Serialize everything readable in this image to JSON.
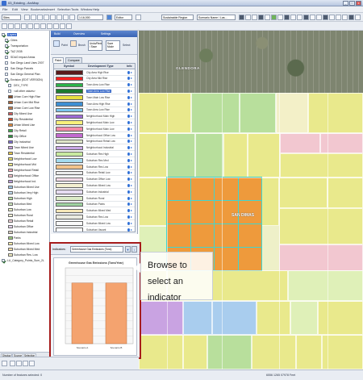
{
  "window": {
    "title": "03_Existing - ArcMap"
  },
  "menu": [
    "File",
    "Edit",
    "View",
    "Bookmarks",
    "Insert",
    "Selection",
    "Tools",
    "Window",
    "Help"
  ],
  "toolbar": {
    "scale": "1:16,000",
    "layer_drop": "Sites",
    "editor": "Editor",
    "zoom_drop": "Sustainable Region",
    "plan_drop": "Scenario Name / Las..."
  },
  "toc": {
    "items": [
      {
        "label": "Layers",
        "level": 0,
        "checked": true,
        "hl": true
      },
      {
        "label": "Cities",
        "level": 1,
        "checked": true
      },
      {
        "label": "Transportation",
        "level": 1,
        "checked": true
      },
      {
        "label": "TAZ 2035",
        "level": 1,
        "checked": true
      },
      {
        "label": "SDAG Impact Areas",
        "level": 1,
        "checked": false
      },
      {
        "label": "San Diego Land Uses 2007",
        "level": 1,
        "checked": false
      },
      {
        "label": "San Diego Parcels",
        "level": 1,
        "checked": false
      },
      {
        "label": "San Diego General Plan",
        "level": 1,
        "checked": false
      },
      {
        "label": "Envision (EDIT VERSION)",
        "level": 1,
        "checked": true
      },
      {
        "label": "DEV_TYPE",
        "level": 2,
        "checked": false
      },
      {
        "label": "<all other values>",
        "level": 2,
        "checked": false
      }
    ],
    "legend": [
      {
        "label": "Urban Core High Rise",
        "color": "#8a4e2a"
      },
      {
        "label": "Urban Core Mid Rise",
        "color": "#a86438"
      },
      {
        "label": "Urban Core Low Rise",
        "color": "#c47c4a"
      },
      {
        "label": "City Mixed Use",
        "color": "#d05a5a"
      },
      {
        "label": "City Residential",
        "color": "#d24b2b"
      },
      {
        "label": "Urban Mixed Use",
        "color": "#e28a3a"
      },
      {
        "label": "City Retail",
        "color": "#3fa84a"
      },
      {
        "label": "City Office",
        "color": "#2f8f3f"
      },
      {
        "label": "City Industrial",
        "color": "#7a6ad0"
      },
      {
        "label": "Town Mixed Use",
        "color": "#c8a3e0"
      },
      {
        "label": "Town Residential",
        "color": "#e3c34a"
      },
      {
        "label": "Neighborhood Low",
        "color": "#e8de6a"
      },
      {
        "label": "Neighborhood Mid",
        "color": "#efe98a"
      },
      {
        "label": "Neighborhood Retail",
        "color": "#f0a7b5"
      },
      {
        "label": "Neighborhood Office",
        "color": "#f4c3cc"
      },
      {
        "label": "Neighborhood Ind.",
        "color": "#b89bd8"
      },
      {
        "label": "Suburban Mixed Use",
        "color": "#9fc7e8"
      },
      {
        "label": "Suburban Very High",
        "color": "#c3dff3"
      },
      {
        "label": "Suburban High",
        "color": "#b9e0a4"
      },
      {
        "label": "Suburban Med",
        "color": "#d2eac0"
      },
      {
        "label": "Suburban Low",
        "color": "#eaf1c6"
      },
      {
        "label": "Suburban Rural",
        "color": "#f5f3d6"
      },
      {
        "label": "Suburban Retail",
        "color": "#f1d2d8"
      },
      {
        "label": "Suburban Office",
        "color": "#e7d6ef"
      },
      {
        "label": "Suburban Industrial",
        "color": "#d8cdbf"
      },
      {
        "label": "Parks",
        "color": "#9ecf7b"
      },
      {
        "label": "Suburban Mixed Low",
        "color": "#f7e9a8"
      },
      {
        "label": "Suburban Mixed Med",
        "color": "#f6dfaa"
      },
      {
        "label": "Suburban Res. Low",
        "color": "#f5f0c2"
      }
    ],
    "extra": [
      {
        "label": "LU_Category_Points_Sum_2L",
        "checked": true
      }
    ],
    "tabs": [
      "Display",
      "Source",
      "Selection"
    ]
  },
  "panel": {
    "header": [
      "Build",
      "Overview",
      "Settings"
    ],
    "tools": {
      "paint": "Paint",
      "brush": "Brush",
      "select": "Select",
      "undo_box": "Undo/Redo / Save",
      "settings_box": "Save Mode"
    },
    "tabs": [
      "Paint",
      "Compare"
    ],
    "table_headers": {
      "symbol": "Symbol",
      "type": "Development Type",
      "info": "Info"
    },
    "rows": [
      {
        "name": "City Area High Rise",
        "color": "#5a1a1a"
      },
      {
        "name": "City Area Mid Rise",
        "color": "#ff2020"
      },
      {
        "name": "Town Area Low Rise",
        "color": "#2bb34a"
      },
      {
        "name": "Town Area Low Rise",
        "color": "#1b7a2f",
        "selected": true
      },
      {
        "name": "Town Main Low Rise",
        "color": "#e8e040"
      },
      {
        "name": "Town Area High Rise",
        "color": "#3d8fd4"
      },
      {
        "name": "Town Area Low Rise",
        "color": "#7bc7ef"
      },
      {
        "name": "Neighborhood Main High",
        "color": "#9c6ad6"
      },
      {
        "name": "Neighborhood Main Low",
        "color": "#f7f07a"
      },
      {
        "name": "Neighborhood Main Low",
        "color": "#f38aa6"
      },
      {
        "name": "Neighborhood Office Low",
        "color": "#c26ad0"
      },
      {
        "name": "Neighborhood Retail Low",
        "color": "#dfe7c8"
      },
      {
        "name": "Neighborhood Industrial",
        "color": "#c9a8e6"
      },
      {
        "name": "Suburban Res High",
        "color": "#c8eaa0"
      },
      {
        "name": "Suburban Res Med",
        "color": "#a4dcf0"
      },
      {
        "name": "Suburban Res Low",
        "color": "#f2c38a"
      },
      {
        "name": "Suburban Retail Low",
        "color": "#ebebeb"
      },
      {
        "name": "Suburban Office Low",
        "color": "#f3dbe8"
      },
      {
        "name": "Suburban Mixed Low",
        "color": "#f3f0d0"
      },
      {
        "name": "Suburban Industrial",
        "color": "#e6dcf2"
      },
      {
        "name": "Suburban Rural",
        "color": "#dcecc8"
      },
      {
        "name": "Suburban Parks",
        "color": "#9ed3a0"
      },
      {
        "name": "Suburban Mixed Med",
        "color": "#f6e7b8"
      },
      {
        "name": "Suburban Res Low",
        "color": "#eaeae0"
      },
      {
        "name": "Suburban Mixed Low",
        "color": "#fafafa"
      },
      {
        "name": "Suburban Vacant",
        "color": "#ffffff"
      }
    ]
  },
  "indicator": {
    "label": "Indicators:",
    "selected": "Greenhouse Gas Emissions (Tons)",
    "chart_data": {
      "type": "bar",
      "title": "Greenhouse Gas Emissions (Tons/Year)",
      "categories": [
        "Scenario A",
        "Scenario B"
      ],
      "values": [
        80,
        80
      ],
      "ylim": [
        0,
        100
      ],
      "grid": true,
      "color": "#f4a36f"
    }
  },
  "callout": {
    "text": "Browse to select an indicator"
  },
  "map": {
    "labels": {
      "aerial": "GLENDORA",
      "district": "SAN DIMAS"
    }
  },
  "status": {
    "left": "Number of features selected: 0",
    "coords": "6556 1265  07978 Feet"
  },
  "colors": {
    "accent": "#3163c6",
    "frame": "#a61c1c"
  }
}
